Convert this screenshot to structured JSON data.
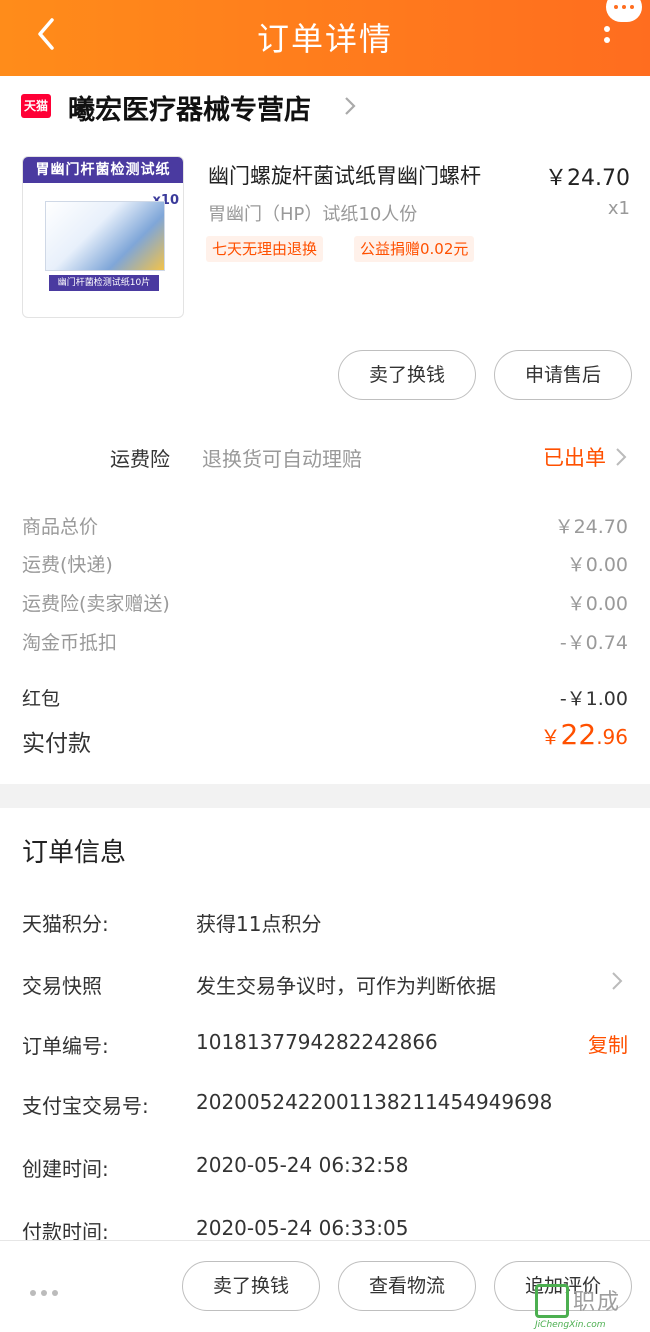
{
  "header": {
    "title": "订单详情"
  },
  "shop": {
    "badge": "天猫",
    "name": "曦宏医疗器械专营店"
  },
  "product": {
    "image_top_text": "胃幽门杆菌检测试纸",
    "image_count": "x10",
    "image_bottom_text": "幽门杆菌检测试纸10片",
    "title": "幽门螺旋杆菌试纸胃幽门螺杆",
    "sku": "胃幽门（HP）试纸10人份",
    "price": "￥24.70",
    "qty": "x1",
    "tags": [
      "七天无理由退换",
      "公益捐赠0.02元"
    ]
  },
  "actions": {
    "sell": "卖了换钱",
    "after_sale": "申请售后"
  },
  "insurance": {
    "label": "运费险",
    "desc": "退换货可自动理赔",
    "status": "已出单"
  },
  "price_rows": [
    {
      "label": "商品总价",
      "value": "￥24.70"
    },
    {
      "label": "运费(快递)",
      "value": "￥0.00"
    },
    {
      "label": "运费险(卖家赠送)",
      "value": "￥0.00"
    },
    {
      "label": "淘金币抵扣",
      "value": "-￥0.74"
    },
    {
      "label": "红包",
      "value": "-￥1.00"
    }
  ],
  "paid": {
    "label": "实付款",
    "currency": "￥",
    "integer": "22",
    "decimal": ".96"
  },
  "order_info": {
    "title": "订单信息",
    "rows": [
      {
        "label": "天猫积分:",
        "value": "获得11点积分"
      },
      {
        "label": "交易快照",
        "value": "发生交易争议时，可作为判断依据"
      },
      {
        "label": "订单编号:",
        "value": "1018137794282242866"
      },
      {
        "label": "支付宝交易号:",
        "value": "2020052422001138211454949698"
      },
      {
        "label": "创建时间:",
        "value": "2020-05-24 06:32:58"
      },
      {
        "label": "付款时间:",
        "value": "2020-05-24 06:33:05"
      }
    ],
    "copy": "复制"
  },
  "bottom": {
    "sell": "卖了换钱",
    "logistics": "查看物流",
    "review": "追加评价"
  },
  "watermark": {
    "text": "职成",
    "sub": "JiChengXin.com"
  },
  "colors": {
    "accent": "#ff5000",
    "header": "#ff7a1c"
  }
}
